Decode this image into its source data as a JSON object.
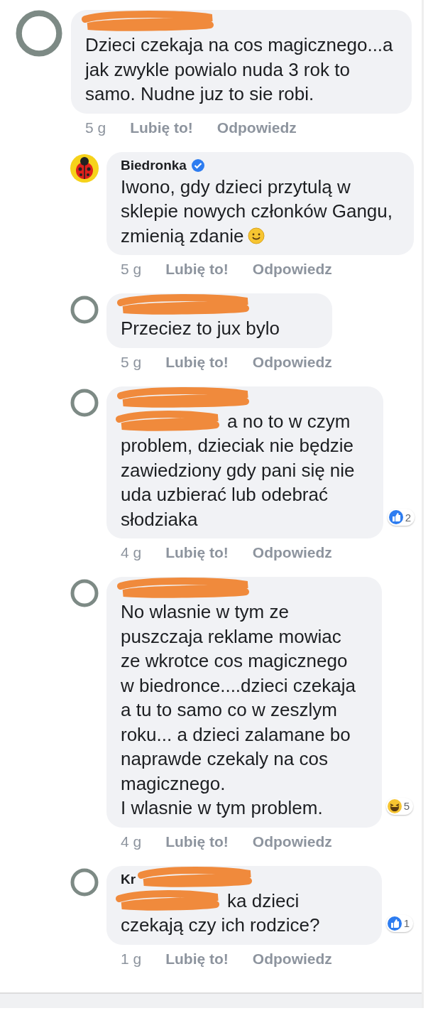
{
  "comments": [
    {
      "reply": false,
      "avatar": {
        "kind": "ring"
      },
      "name_redacted": true,
      "text": "Dzieci czekaja na cos magicznego...a jak zwykle powialo nuda 3 rok to samo. Nudne juz to sie robi.",
      "time": "5 g",
      "like": "Lubię to!",
      "answer": "Odpowiedz"
    },
    {
      "reply": true,
      "avatar": {
        "kind": "ladybug"
      },
      "name": "Biedronka",
      "verified": true,
      "text": "Iwono, gdy dzieci przytulą w sklepie nowych członków Gangu, zmienią zdanie",
      "emoji": {
        "kind": "smile"
      },
      "time": "5 g",
      "like": "Lubię to!",
      "answer": "Odpowiedz"
    },
    {
      "reply": true,
      "avatar": {
        "kind": "ring"
      },
      "name_redacted": true,
      "text": "Przeciez to jux bylo",
      "time": "5 g",
      "like": "Lubię to!",
      "answer": "Odpowiedz"
    },
    {
      "reply": true,
      "avatar": {
        "kind": "ring"
      },
      "name_redacted": true,
      "text_redacted_start": true,
      "text": "a no to w czym problem, dzieciak nie będzie zawiedziony gdy pani się nie uda uzbierać lub odebrać słodziaka",
      "reaction": {
        "kind": "like",
        "count": "2"
      },
      "time": "4 g",
      "like": "Lubię to!",
      "answer": "Odpowiedz"
    },
    {
      "reply": true,
      "avatar": {
        "kind": "ring"
      },
      "name_redacted": true,
      "text": "No wlasnie w tym ze puszczaja reklame mowiac ze wkrotce cos magicznego w biedronce....dzieci czekaja a tu to samo co w zeszlym roku... a dzieci zalamane bo naprawde czekaly na cos magicznego.\nI wlasnie w tym problem.",
      "reaction": {
        "kind": "haha",
        "count": "5"
      },
      "time": "4 g",
      "like": "Lubię to!",
      "answer": "Odpowiedz"
    },
    {
      "reply": true,
      "avatar": {
        "kind": "ring"
      },
      "name": "Kr",
      "name_redacted": true,
      "text_redacted_start": true,
      "text": "ka dzieci czekają czy ich rodzice?",
      "reaction": {
        "kind": "like",
        "count": "1"
      },
      "time": "1 g",
      "like": "Lubię to!",
      "answer": "Odpowiedz"
    }
  ]
}
